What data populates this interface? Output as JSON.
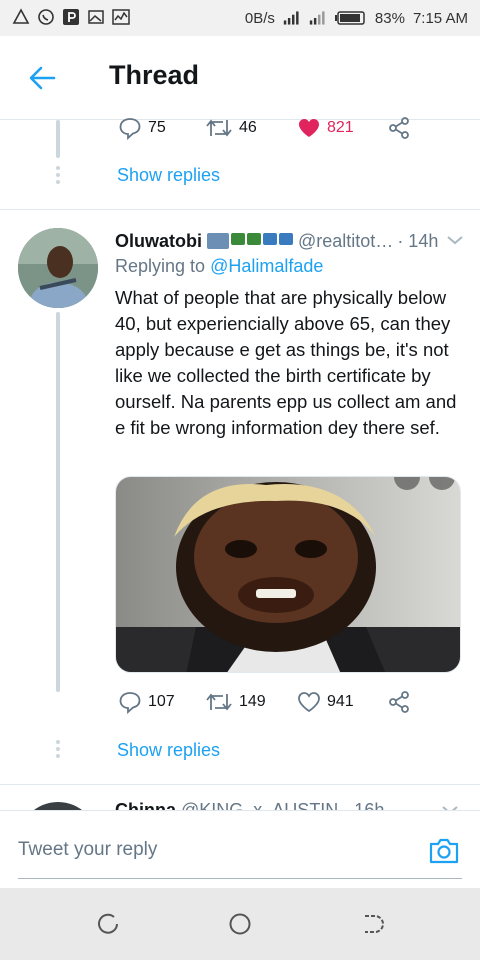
{
  "status_bar": {
    "net_speed": "0B/s",
    "battery": "83%",
    "time": "7:15 AM",
    "icons": [
      "alert-icon",
      "whatsapp-icon",
      "pinterest-icon",
      "gallery-icon",
      "activity-icon",
      "signal-icon",
      "signal-icon",
      "battery-icon"
    ]
  },
  "header": {
    "title": "Thread",
    "back_icon": "arrow-left-icon"
  },
  "prev_tweet": {
    "replies": "75",
    "retweets": "46",
    "likes": "821",
    "liked": true,
    "show_replies": "Show replies"
  },
  "tweet": {
    "name": "Oluwatobi",
    "handle": "@realtitot…",
    "time": "· 14h",
    "replying_label": "Replying to",
    "replying_to": "@Halimalfade",
    "text": "What of people that are physically below 40, but experiencially above 65, can they apply because e get as things be, it's not like we collected the birth certificate by ourself. Na parents epp us collect am and e fit be wrong information dey there sef.",
    "replies": "107",
    "retweets": "149",
    "likes": "941",
    "show_replies": "Show replies"
  },
  "next_tweet": {
    "name": "Chinna",
    "rest": " @KING_x_AUSTIN · 16h"
  },
  "reply_bar": {
    "placeholder": "Tweet your reply"
  },
  "colors": {
    "accent": "#1da1f2",
    "like_active": "#e0245e",
    "muted": "#657786",
    "divider": "#e1e8ed"
  }
}
